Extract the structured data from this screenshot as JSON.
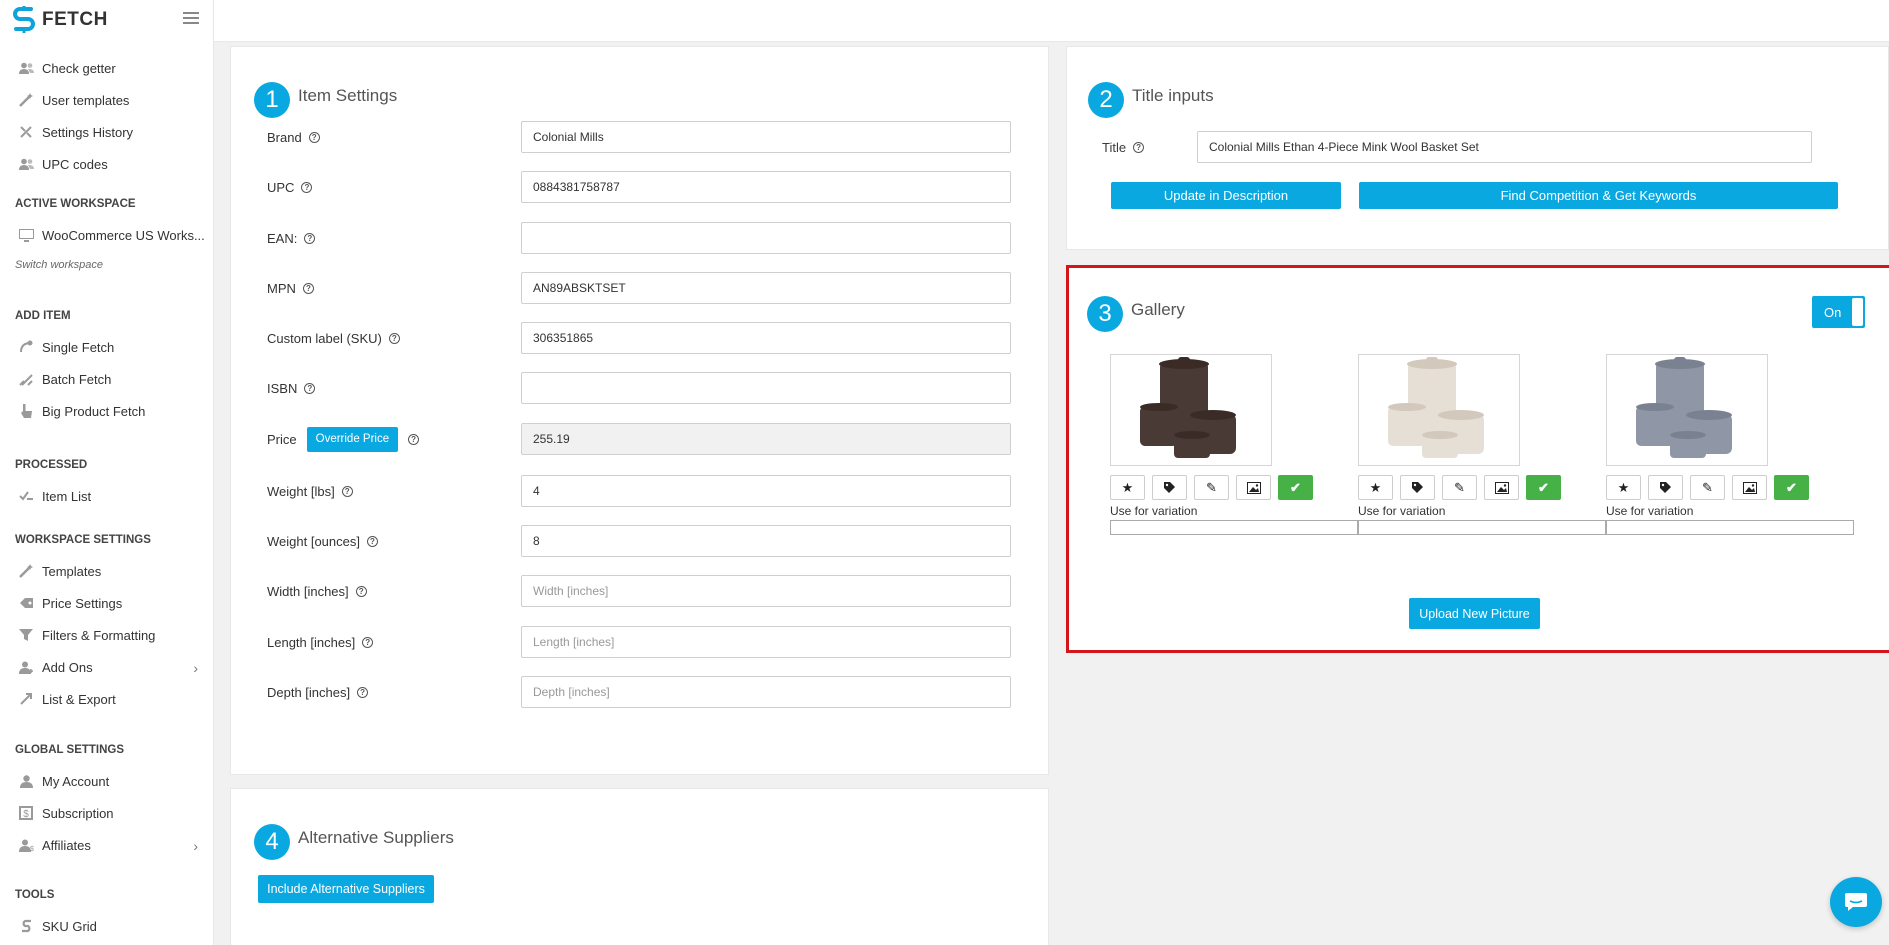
{
  "app": {
    "name": "FETCH"
  },
  "sidebar": {
    "group1": [
      {
        "label": "Check getter",
        "icon": "users-icon"
      },
      {
        "label": "User templates",
        "icon": "magic-wand-icon"
      },
      {
        "label": "Settings History",
        "icon": "history-icon"
      },
      {
        "label": "UPC codes",
        "icon": "users-icon"
      }
    ],
    "active_workspace": {
      "title": "ACTIVE WORKSPACE",
      "workspace": "WooCommerce US Works...",
      "switch": "Switch workspace"
    },
    "add_item": {
      "title": "ADD ITEM",
      "items": [
        {
          "label": "Single Fetch",
          "icon": "fetch-icon"
        },
        {
          "label": "Batch Fetch",
          "icon": "batch-icon"
        },
        {
          "label": "Big Product Fetch",
          "icon": "hand-icon"
        }
      ]
    },
    "processed": {
      "title": "PROCESSED",
      "items": [
        {
          "label": "Item List",
          "icon": "checklist-icon"
        }
      ]
    },
    "workspace_settings": {
      "title": "WORKSPACE SETTINGS",
      "items": [
        {
          "label": "Templates",
          "icon": "magic-wand-icon"
        },
        {
          "label": "Price Settings",
          "icon": "price-tag-icon"
        },
        {
          "label": "Filters & Formatting",
          "icon": "filter-icon"
        },
        {
          "label": "Add Ons",
          "icon": "user-plus-icon"
        },
        {
          "label": "List & Export",
          "icon": "export-icon"
        }
      ]
    },
    "global_settings": {
      "title": "GLOBAL SETTINGS",
      "items": [
        {
          "label": "My Account",
          "icon": "user-icon"
        },
        {
          "label": "Subscription",
          "icon": "subscription-icon"
        },
        {
          "label": "Affiliates",
          "icon": "user-dollar-icon"
        }
      ]
    },
    "tools": {
      "title": "TOOLS",
      "items": [
        {
          "label": "SKU Grid",
          "icon": "dollar-icon"
        }
      ]
    }
  },
  "item_settings": {
    "step": "1",
    "title": "Item Settings",
    "override_price": "Override Price",
    "fields": [
      {
        "label": "Brand",
        "value": "Colonial Mills",
        "placeholder": ""
      },
      {
        "label": "UPC",
        "value": "0884381758787",
        "placeholder": ""
      },
      {
        "label": "EAN:",
        "value": "",
        "placeholder": ""
      },
      {
        "label": "MPN",
        "value": "AN89ABSKTSET",
        "placeholder": ""
      },
      {
        "label": "Custom label (SKU)",
        "value": "306351865",
        "placeholder": ""
      },
      {
        "label": "ISBN",
        "value": "",
        "placeholder": ""
      },
      {
        "label": "Price",
        "value": "255.19",
        "placeholder": ""
      },
      {
        "label": "Weight [lbs]",
        "value": "4",
        "placeholder": ""
      },
      {
        "label": "Weight [ounces]",
        "value": "8",
        "placeholder": ""
      },
      {
        "label": "Width [inches]",
        "value": "",
        "placeholder": "Width [inches]"
      },
      {
        "label": "Length [inches]",
        "value": "",
        "placeholder": "Length [inches]"
      },
      {
        "label": "Depth [inches]",
        "value": "",
        "placeholder": "Depth [inches]"
      }
    ]
  },
  "title_inputs": {
    "step": "2",
    "title": "Title inputs",
    "title_label": "Title",
    "title_value": "Colonial Mills Ethan 4-Piece Mink Wool Basket Set",
    "update_button": "Update in Description",
    "competition_button": "Find Competition & Get Keywords"
  },
  "gallery": {
    "step": "3",
    "title": "Gallery",
    "toggle": "On",
    "variation_label": "Use for variation",
    "upload_button": "Upload New Picture",
    "images": [
      {
        "alt": "dark brown basket set",
        "basket_color": "#4a3a35",
        "rim_color": "#3a2b27"
      },
      {
        "alt": "cream basket set",
        "basket_color": "#e6dfd6",
        "rim_color": "#d2c8bc"
      },
      {
        "alt": "grey basket set",
        "basket_color": "#8f97a6",
        "rim_color": "#7a8292"
      }
    ]
  },
  "alternative_suppliers": {
    "step": "4",
    "title": "Alternative Suppliers",
    "button": "Include Alternative Suppliers"
  },
  "colors": {
    "accent": "#0aa8e0",
    "success": "#46b146",
    "highlight": "#d2161b"
  }
}
